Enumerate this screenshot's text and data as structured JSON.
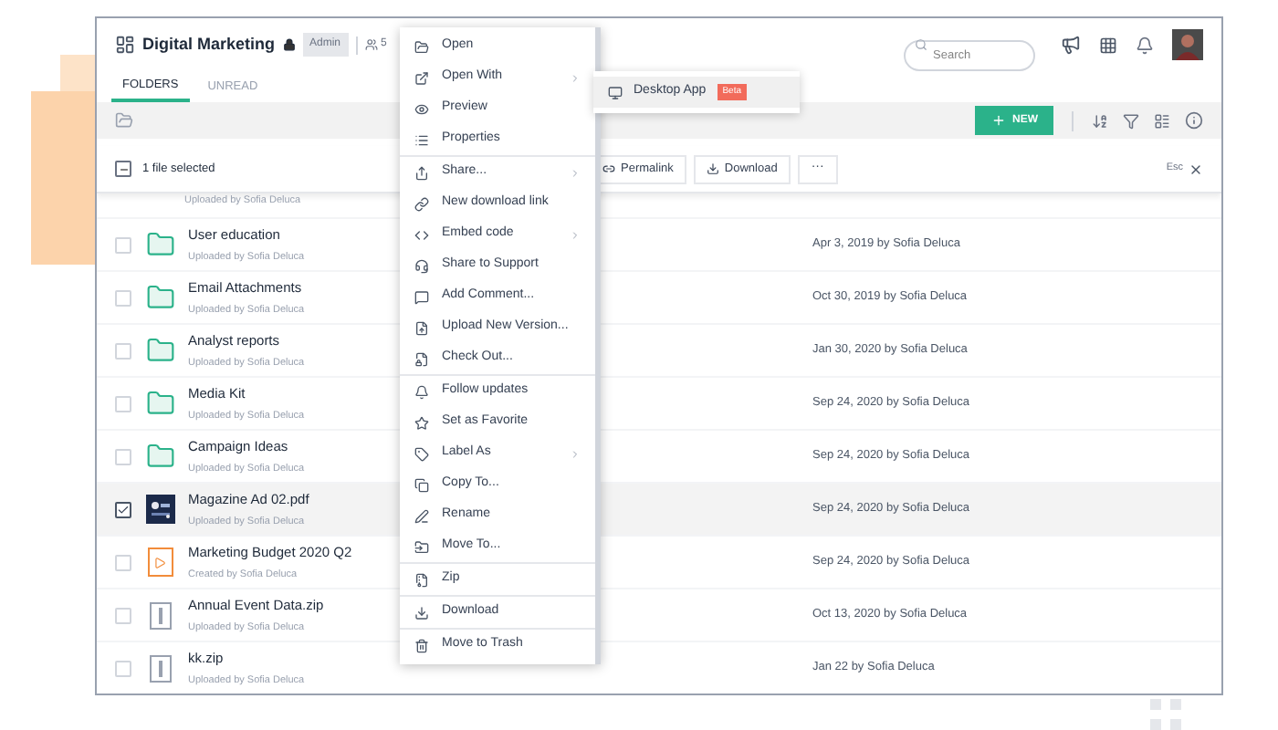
{
  "header": {
    "title": "Digital Marketing",
    "role_badge": "Admin",
    "member_count": "5"
  },
  "search": {
    "placeholder": "Search"
  },
  "tabs": [
    {
      "label": "FOLDERS",
      "selected": true
    },
    {
      "label": "UNREAD",
      "selected": false
    }
  ],
  "toolbar": {
    "new_button": "NEW"
  },
  "selection_bar": {
    "indeterminate": true,
    "count_text": "1 file selected",
    "actions": [
      "Permalink",
      "Download"
    ],
    "more": "···",
    "esc": "Esc"
  },
  "clipped_row": {
    "subtitle": "Uploaded by Sofia Deluca"
  },
  "files": [
    {
      "name": "User education",
      "subtitle": "Uploaded by Sofia Deluca",
      "date": "Apr 3, 2019 by Sofia Deluca",
      "kind": "folder",
      "checked": false,
      "selected": false
    },
    {
      "name": "Email Attachments",
      "subtitle": "Uploaded by Sofia Deluca",
      "date": "Oct 30, 2019 by Sofia Deluca",
      "kind": "folder",
      "checked": false,
      "selected": false
    },
    {
      "name": "Analyst reports",
      "subtitle": "Uploaded by Sofia Deluca",
      "date": "Jan 30, 2020 by Sofia Deluca",
      "kind": "folder",
      "checked": false,
      "selected": false
    },
    {
      "name": "Media Kit",
      "subtitle": "Uploaded by Sofia Deluca",
      "date": "Sep 24, 2020 by Sofia Deluca",
      "kind": "folder",
      "checked": false,
      "selected": false
    },
    {
      "name": "Campaign Ideas",
      "subtitle": "Uploaded by Sofia Deluca",
      "date": "Sep 24, 2020 by Sofia Deluca",
      "kind": "folder",
      "checked": false,
      "selected": false
    },
    {
      "name": "Magazine Ad 02.pdf",
      "subtitle": "Uploaded by Sofia Deluca",
      "date": "Sep 24, 2020 by Sofia Deluca",
      "checked": true,
      "selected": true
    },
    {
      "name": "Marketing Budget 2020 Q2",
      "subtitle": "Created by Sofia Deluca",
      "date": "Sep 24, 2020 by Sofia Deluca",
      "kind": "video",
      "checked": false,
      "selected": false
    },
    {
      "name": "Annual Event Data.zip",
      "subtitle": "Uploaded by Sofia Deluca",
      "date": "Oct 13, 2020 by Sofia Deluca",
      "kind": "zip",
      "checked": false,
      "selected": false
    },
    {
      "name": "kk.zip",
      "subtitle": "Uploaded by Sofia Deluca",
      "date": "Jan 22 by Sofia Deluca",
      "kind": "zip",
      "checked": false,
      "selected": false
    }
  ],
  "context_menu": {
    "sections": [
      [
        {
          "label": "Open",
          "submenu": false
        },
        {
          "label": "Open With",
          "submenu": true
        },
        {
          "label": "Preview",
          "submenu": false
        },
        {
          "label": "Properties",
          "submenu": false
        }
      ],
      [
        {
          "label": "Share...",
          "submenu": true
        },
        {
          "label": "New download link",
          "submenu": false
        },
        {
          "label": "Embed code",
          "submenu": true
        },
        {
          "label": "Share to Support",
          "submenu": false
        },
        {
          "label": "Add Comment...",
          "submenu": false
        },
        {
          "label": "Upload New Version...",
          "submenu": false
        },
        {
          "label": "Check Out...",
          "submenu": false
        }
      ],
      [
        {
          "label": "Follow updates",
          "submenu": false
        },
        {
          "label": "Set as Favorite",
          "submenu": false
        },
        {
          "label": "Label As",
          "submenu": true
        },
        {
          "label": "Copy To...",
          "submenu": false
        },
        {
          "label": "Rename",
          "submenu": false
        },
        {
          "label": "Move To...",
          "submenu": false
        }
      ],
      [
        {
          "label": "Zip",
          "submenu": false
        }
      ],
      [
        {
          "label": "Download",
          "submenu": false
        }
      ],
      [
        {
          "label": "Move to Trash",
          "submenu": false
        }
      ]
    ]
  },
  "submenu": {
    "label": "Desktop App",
    "badge": "Beta"
  }
}
